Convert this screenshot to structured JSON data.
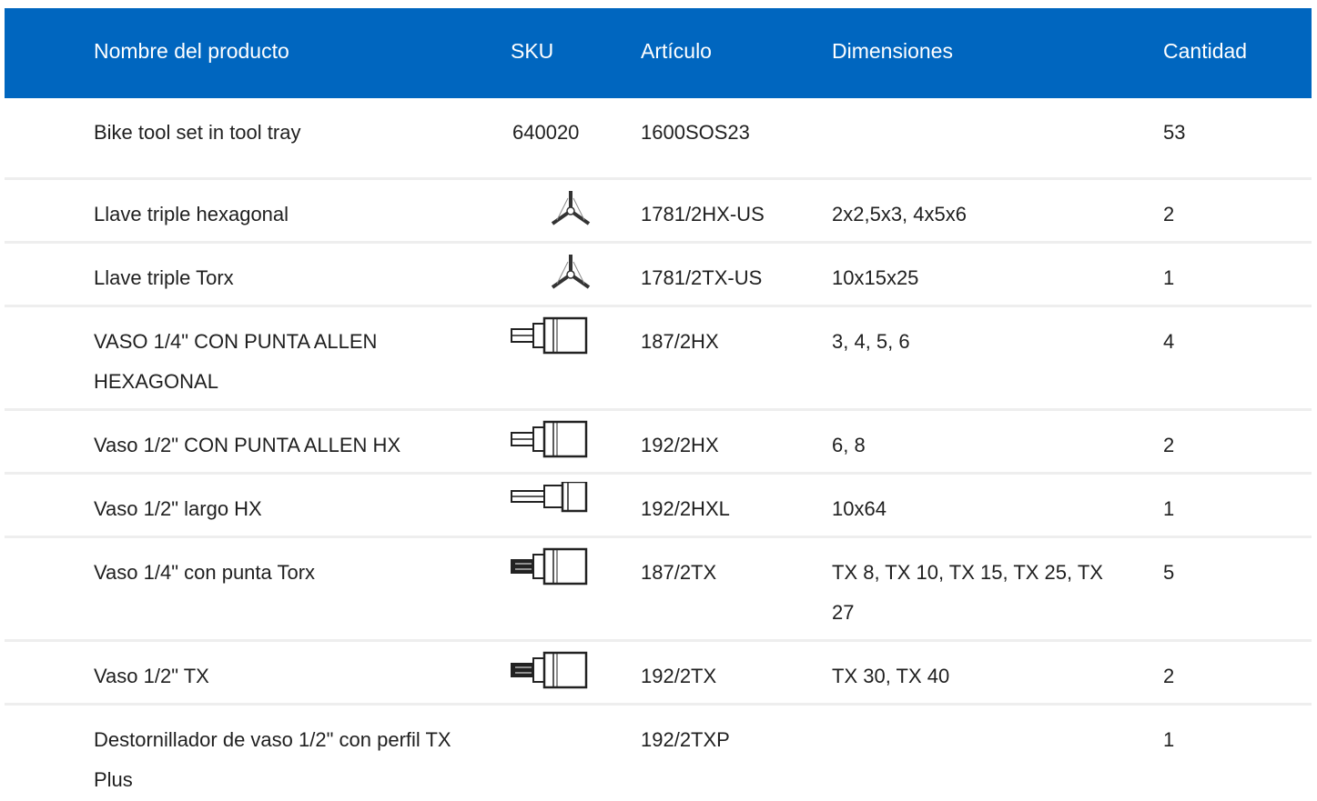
{
  "header": {
    "name": "Nombre del producto",
    "sku": "SKU",
    "article": "Artículo",
    "dimensions": "Dimensiones",
    "quantity": "Cantidad"
  },
  "rows": [
    {
      "name": "Bike tool set in tool tray",
      "sku": "640020",
      "article": "1600SOS23",
      "dimensions": "",
      "quantity": "53",
      "icon": ""
    },
    {
      "name": "Llave triple hexagonal",
      "sku": "",
      "article": "1781/2HX-US",
      "dimensions": "2x2,5x3, 4x5x6",
      "quantity": "2",
      "icon": "triple-wrench-icon"
    },
    {
      "name": "Llave triple Torx",
      "sku": "",
      "article": "1781/2TX-US",
      "dimensions": "10x15x25",
      "quantity": "1",
      "icon": "triple-wrench-icon"
    },
    {
      "name": "VASO 1/4\" CON PUNTA ALLEN HEXAGONAL",
      "sku": "",
      "article": "187/2HX",
      "dimensions": "3, 4, 5, 6",
      "quantity": "4",
      "icon": "hex-bit-socket-icon"
    },
    {
      "name": "Vaso 1/2\" CON PUNTA ALLEN HX",
      "sku": "",
      "article": "192/2HX",
      "dimensions": "6, 8",
      "quantity": "2",
      "icon": "hex-bit-socket-icon"
    },
    {
      "name": "Vaso 1/2\" largo HX",
      "sku": "",
      "article": "192/2HXL",
      "dimensions": "10x64",
      "quantity": "1",
      "icon": "long-hex-bit-socket-icon"
    },
    {
      "name": "Vaso 1/4\" con punta Torx",
      "sku": "",
      "article": "187/2TX",
      "dimensions": "TX 8, TX 10, TX 15, TX 25, TX 27",
      "quantity": "5",
      "icon": "torx-bit-socket-icon"
    },
    {
      "name": "Vaso 1/2\" TX",
      "sku": "",
      "article": "192/2TX",
      "dimensions": "TX 30, TX 40",
      "quantity": "2",
      "icon": "torx-bit-socket-icon"
    },
    {
      "name": "Destornillador de vaso 1/2\" con perfil TX Plus",
      "sku": "",
      "article": "192/2TXP",
      "dimensions": "",
      "quantity": "1",
      "icon": ""
    }
  ],
  "colors": {
    "header_bg": "#0066bf",
    "header_text": "#ffffff",
    "divider": "#eeeeee",
    "text": "#1f1f1f"
  }
}
